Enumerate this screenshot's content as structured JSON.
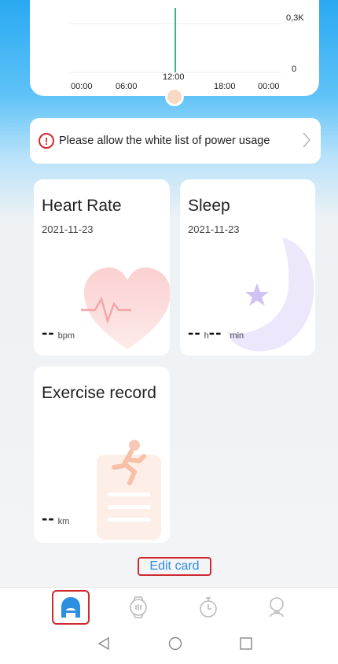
{
  "chart": {
    "y_max_label": "0,3K",
    "y_min_label": "0",
    "x_labels": [
      "00:00",
      "06:00",
      "12:00",
      "18:00",
      "00:00"
    ],
    "accent_color": "#3fb589"
  },
  "notice": {
    "text": "Please allow the white list of power usage",
    "icon": "exclamation-circle-icon",
    "color": "#d4282c"
  },
  "cards": {
    "heart_rate": {
      "title": "Heart Rate",
      "date": "2021-11-23",
      "value": "--",
      "unit": "bpm"
    },
    "sleep": {
      "title": "Sleep",
      "date": "2021-11-23",
      "hours": "--",
      "hours_unit": "h",
      "minutes": "--",
      "minutes_unit": "min"
    },
    "exercise": {
      "title": "Exercise record",
      "value": "--",
      "unit": "km"
    }
  },
  "edit_card_label": "Edit card",
  "bottom_nav": {
    "items": [
      {
        "icon": "home-icon",
        "active": true
      },
      {
        "icon": "watch-icon",
        "active": false
      },
      {
        "icon": "timer-icon",
        "active": false
      },
      {
        "icon": "profile-icon",
        "active": false
      }
    ],
    "active_color": "#2d8fe0"
  },
  "system_nav": [
    "back-icon",
    "home-circle-icon",
    "recents-square-icon"
  ]
}
